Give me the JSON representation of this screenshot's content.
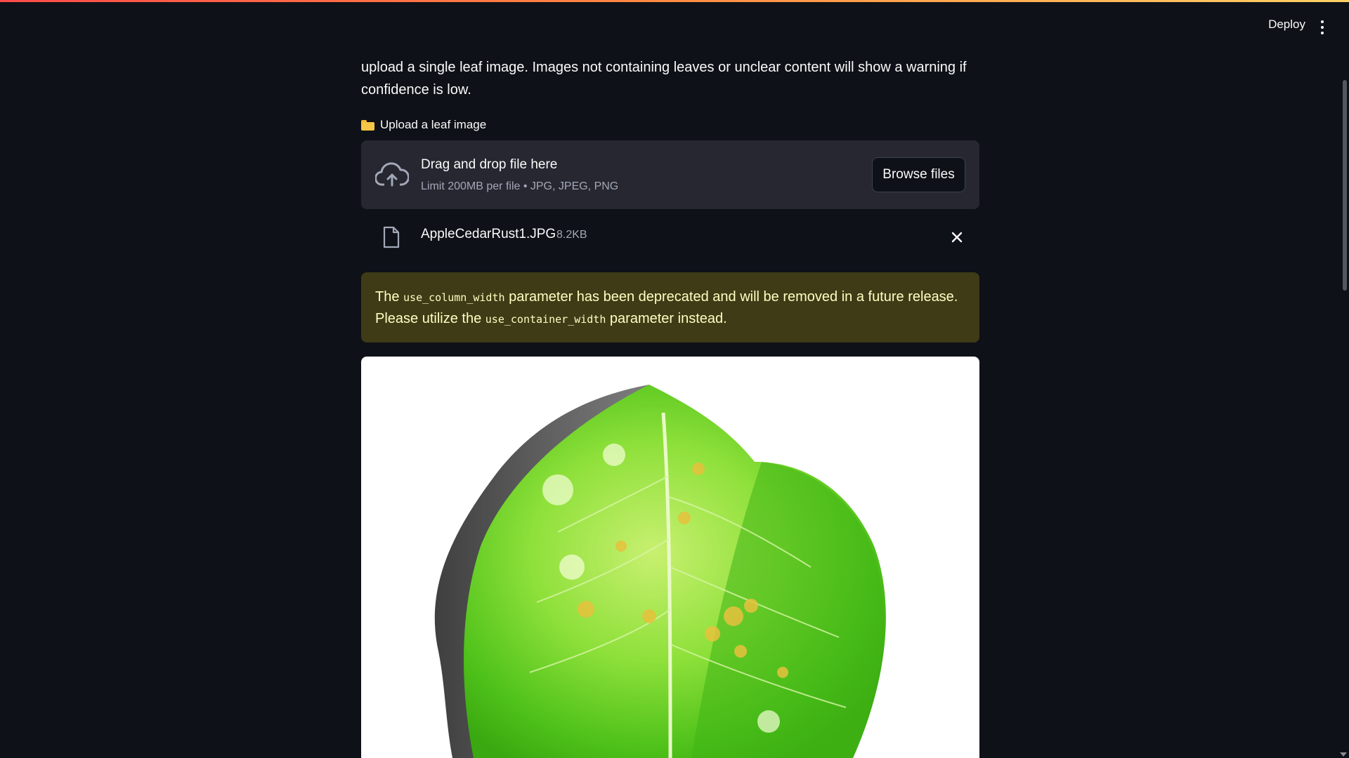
{
  "header": {
    "deploy_label": "Deploy",
    "menu_icon": "vertical-ellipsis-icon"
  },
  "intro": {
    "text": "upload a single leaf image. Images not containing leaves or unclear content will show a warning if confidence is low."
  },
  "uploader": {
    "label_icon": "folder-icon",
    "label": "Upload a leaf image",
    "drop_title": "Drag and drop file here",
    "drop_subtitle": "Limit 200MB per file • JPG, JPEG, PNG",
    "browse_label": "Browse files",
    "file": {
      "name": "AppleCedarRust1.JPG",
      "size": "8.2KB"
    }
  },
  "warning": {
    "prefix": "The ",
    "code1": "use_column_width",
    "middle": " parameter has been deprecated and will be removed in a future release. Please utilize the ",
    "code2": "use_container_width",
    "suffix": " parameter instead.",
    "color_bg": "#3e3b16",
    "color_text": "#ffffc2"
  },
  "colors": {
    "background": "#0e1117",
    "dropzone": "#262730",
    "text": "#fafafa",
    "muted": "#a3a8b8"
  }
}
